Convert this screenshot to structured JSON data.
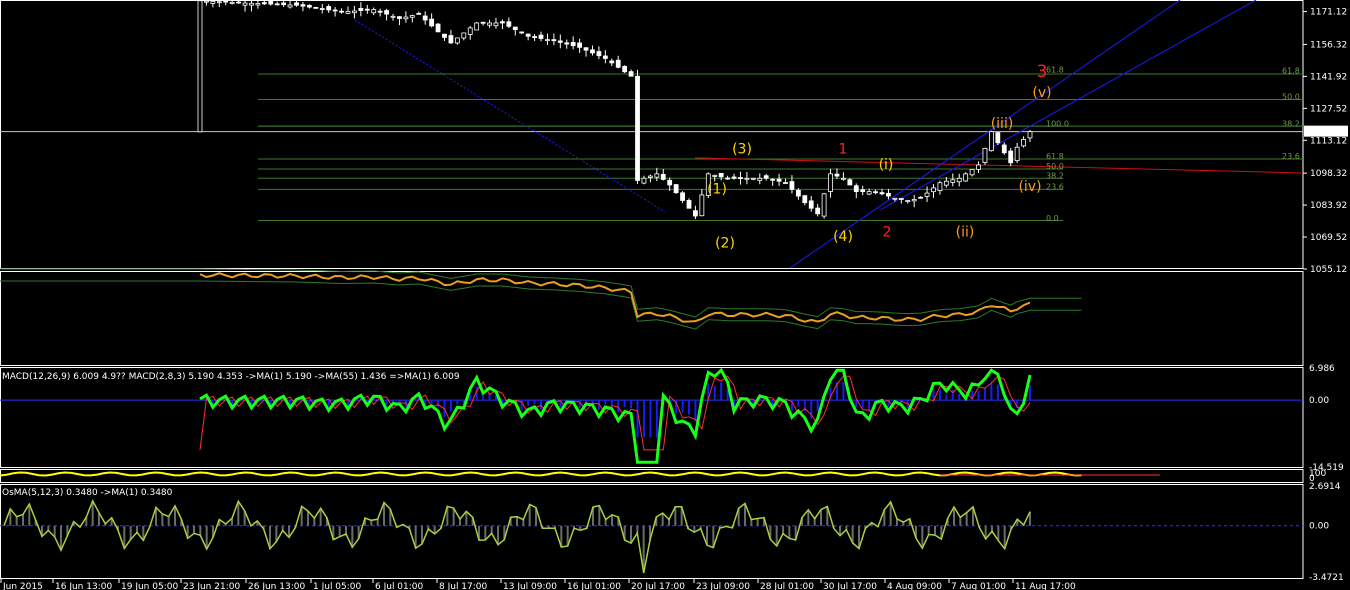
{
  "colors": {
    "background": "#000000",
    "frame": "#ffffff",
    "bull_candle": "#ffffff",
    "bear_candle": "#ffffff",
    "fib_line": "#3c7a2c",
    "fib_label": "#6f9a4a",
    "channel": "#1a1aff",
    "wave_red": "#ff2020",
    "wave_yellow": "#ffd700",
    "wave_orange": "#ff9a1a",
    "macd_main": "#18ff18",
    "macd_signal": "#ff3030",
    "macd_hist": "#1a1aff",
    "osma_line": "#a8d040",
    "ind1_line": "#e8a020",
    "ind1_band": "#2e7a2e",
    "ind2_line": "#ffff00"
  },
  "price_axis": {
    "labels": [
      "1171.12",
      "1156.32",
      "1141.92",
      "1127.52",
      "1113.12",
      "1098.32",
      "1083.92",
      "1069.52",
      "1055.12"
    ],
    "current": "1117.02",
    "ylim": [
      1055.12,
      1175
    ]
  },
  "time_axis": {
    "labels": [
      "Jun 2015",
      "16 Jun 13:00",
      "19 Jun 05:00",
      "23 Jun 21:00",
      "26 Jun 13:00",
      "1 Jul 05:00",
      "6 Jul 01:00",
      "8 Jul 17:00",
      "13 Jul 09:00",
      "16 Jul 01:00",
      "20 Jul 17:00",
      "23 Jul 09:00",
      "28 Jul 01:00",
      "30 Jul 17:00",
      "4 Aug 09:00",
      "7 Aug 01:00",
      "11 Aug 17:00"
    ]
  },
  "fib_labels": [
    {
      "text": "61.8",
      "price": 1144.5,
      "idx": 163
    },
    {
      "text": "50.0",
      "price": 1132.8,
      "idx": 163
    },
    {
      "text": "38.2",
      "price": 1120.8,
      "idx": 163
    },
    {
      "text": "23.6",
      "price": 1106.0,
      "idx": 163
    },
    {
      "text": "100.0",
      "price": 1120.8,
      "idx": 132
    },
    {
      "text": "61.8",
      "price": 1106.0,
      "idx": 132
    },
    {
      "text": "50.0",
      "price": 1101.6,
      "idx": 132
    },
    {
      "text": "38.2",
      "price": 1097.2,
      "idx": 132
    },
    {
      "text": "23.6",
      "price": 1092.2,
      "idx": 132
    },
    {
      "text": "0.0",
      "price": 1078.2,
      "idx": 132
    },
    {
      "text": "61.8",
      "price": 1145.0,
      "idx": 132
    }
  ],
  "wave_labels": [
    {
      "text": "3",
      "price": 1144.0,
      "idx": 162,
      "color": "wave_red"
    },
    {
      "text": "(v)",
      "price": 1135.0,
      "idx": 162,
      "color": "wave_orange"
    },
    {
      "text": "(iii)",
      "price": 1121.0,
      "idx": 156,
      "color": "wave_orange"
    },
    {
      "text": "(iv)",
      "price": 1092.5,
      "idx": 160,
      "color": "wave_orange"
    },
    {
      "text": "(ii)",
      "price": 1072.0,
      "idx": 150,
      "color": "wave_orange"
    },
    {
      "text": "(i)",
      "price": 1102.5,
      "idx": 137,
      "color": "wave_yellow"
    },
    {
      "text": "1",
      "price": 1109.5,
      "idx": 131,
      "color": "wave_red"
    },
    {
      "text": "2",
      "price": 1072.0,
      "idx": 137,
      "color": "wave_red"
    },
    {
      "text": "(3)",
      "price": 1109.5,
      "idx": 113,
      "color": "wave_yellow"
    },
    {
      "text": "(1)",
      "price": 1091.5,
      "idx": 108,
      "color": "wave_yellow"
    },
    {
      "text": "(4)",
      "price": 1070.0,
      "idx": 129,
      "color": "wave_yellow"
    },
    {
      "text": "(2)",
      "price": 1067.0,
      "idx": 110,
      "color": "wave_yellow"
    }
  ],
  "macd_panel": {
    "label": "MACD(12,26,9) 6.009 4.9??  MACD(2,8,3) 5.190 4.353 ->MA(1) 5.190 ->MA(55) 1.436 =>MA(1) 6.009",
    "axis_labels": [
      "6.986",
      "0.00",
      "-14.519"
    ]
  },
  "mini_panel": {
    "axis_labels": [
      "100",
      "0"
    ]
  },
  "osma_panel": {
    "label": "OsMA(5,12,3) 0.3480 ->MA(1) 0.3480",
    "axis_labels": [
      "2.6914",
      "0.00",
      "-3.4721"
    ]
  },
  "chart_data": {
    "type": "candlestick",
    "instrument_range": [
      1055.12,
      1175
    ],
    "x": {
      "start_index": 0,
      "end_index": 170,
      "tick_labels": [
        "Jun 2015",
        "16 Jun 13:00",
        "19 Jun 05:00",
        "23 Jun 21:00",
        "26 Jun 13:00",
        "1 Jul 05:00",
        "6 Jul 01:00",
        "8 Jul 17:00",
        "13 Jul 09:00",
        "16 Jul 01:00",
        "20 Jul 17:00",
        "23 Jul 09:00",
        "28 Jul 01:00",
        "30 Jul 17:00",
        "4 Aug 09:00",
        "7 Aug 01:00",
        "11 Aug 17:00"
      ]
    },
    "price_waypoints": [
      [
        33,
        1176
      ],
      [
        40,
        1175
      ],
      [
        48,
        1174
      ],
      [
        55,
        1171
      ],
      [
        60,
        1172
      ],
      [
        64,
        1168
      ],
      [
        67,
        1170
      ],
      [
        70,
        1162
      ],
      [
        72,
        1157
      ],
      [
        76,
        1166
      ],
      [
        80,
        1166
      ],
      [
        84,
        1160
      ],
      [
        88,
        1158
      ],
      [
        92,
        1155
      ],
      [
        96,
        1150
      ],
      [
        100,
        1142
      ],
      [
        101,
        1095
      ],
      [
        104,
        1098
      ],
      [
        106,
        1093
      ],
      [
        108,
        1086
      ],
      [
        110,
        1079
      ],
      [
        112,
        1098
      ],
      [
        115,
        1096
      ],
      [
        118,
        1096
      ],
      [
        121,
        1096
      ],
      [
        124,
        1094
      ],
      [
        127,
        1085
      ],
      [
        129,
        1080
      ],
      [
        131,
        1098
      ],
      [
        133,
        1096
      ],
      [
        135,
        1090
      ],
      [
        137,
        1090
      ],
      [
        139,
        1089
      ],
      [
        141,
        1087
      ],
      [
        143,
        1086
      ],
      [
        145,
        1087
      ],
      [
        148,
        1094
      ],
      [
        151,
        1096
      ],
      [
        154,
        1102
      ],
      [
        156,
        1117
      ],
      [
        157,
        1112
      ],
      [
        159,
        1103
      ],
      [
        160,
        1110
      ],
      [
        162,
        1117
      ]
    ],
    "fib_levels": {
      "upper": [
        {
          "label": "61.8",
          "price": 1143.0
        },
        {
          "label": "50.0",
          "price": 1131.5
        },
        {
          "label": "38.2",
          "price": 1119.5
        },
        {
          "label": "23.6",
          "price": 1104.7
        }
      ],
      "lower": [
        {
          "label": "100.0",
          "price": 1119.5
        },
        {
          "label": "61.8",
          "price": 1104.7
        },
        {
          "label": "50.0",
          "price": 1100.2
        },
        {
          "label": "38.2",
          "price": 1096.0
        },
        {
          "label": "23.6",
          "price": 1091.0
        },
        {
          "label": "0.0",
          "price": 1077.0
        }
      ]
    },
    "current_price": 1117.02,
    "macd": {
      "ylim": [
        -14.519,
        6.986
      ],
      "main": 6.009,
      "signal": 4.353
    },
    "osma": {
      "ylim": [
        -3.4721,
        2.6914
      ],
      "value": 0.348
    }
  }
}
